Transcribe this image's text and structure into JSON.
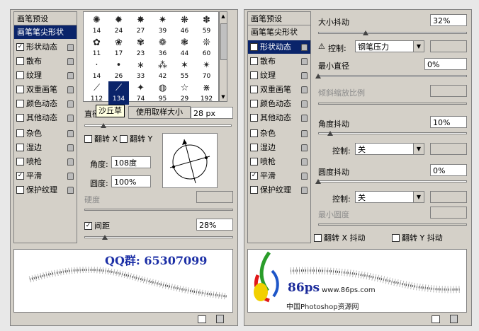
{
  "left": {
    "list": [
      {
        "label": "画笔预设",
        "check": false,
        "lock": false,
        "header": true
      },
      {
        "label": "画笔笔尖形状",
        "check": false,
        "lock": false,
        "selected": true
      },
      {
        "label": "形状动态",
        "check": true,
        "lock": true
      },
      {
        "label": "散布",
        "check": false,
        "lock": true
      },
      {
        "label": "纹理",
        "check": false,
        "lock": true
      },
      {
        "label": "双重画笔",
        "check": false,
        "lock": true
      },
      {
        "label": "颜色动态",
        "check": false,
        "lock": true
      },
      {
        "label": "其他动态",
        "check": false,
        "lock": true
      },
      {
        "label": "杂色",
        "check": false,
        "lock": true
      },
      {
        "label": "湿边",
        "check": false,
        "lock": true
      },
      {
        "label": "喷枪",
        "check": false,
        "lock": true
      },
      {
        "label": "平滑",
        "check": true,
        "lock": true
      },
      {
        "label": "保护纹理",
        "check": false,
        "lock": true
      }
    ],
    "brush_sizes": [
      "14",
      "24",
      "27",
      "39",
      "46",
      "59",
      "11",
      "17",
      "23",
      "36",
      "44",
      "60",
      "14",
      "26",
      "33",
      "42",
      "55",
      "70",
      "112",
      "134",
      "74",
      "95",
      "29",
      "192"
    ],
    "tooltip": "沙丘草",
    "diameter_label": "直径",
    "use_sample_button": "使用取样大小",
    "diameter_value": "28 px",
    "flip_x": "翻转 X",
    "flip_y": "翻转 Y",
    "angle_label": "角度:",
    "angle_value": "108度",
    "roundness_label": "圆度:",
    "roundness_value": "100%",
    "hardness_label": "硬度",
    "spacing_label": "间距",
    "spacing_value": "28%",
    "watermark": "QQ群: 65307099"
  },
  "right": {
    "list": [
      {
        "label": "画笔预设",
        "check": false,
        "lock": false,
        "header": true
      },
      {
        "label": "画笔笔尖形状",
        "check": false,
        "lock": false
      },
      {
        "label": "形状动态",
        "check": true,
        "lock": true,
        "selected": true
      },
      {
        "label": "散布",
        "check": false,
        "lock": true
      },
      {
        "label": "纹理",
        "check": false,
        "lock": true
      },
      {
        "label": "双重画笔",
        "check": false,
        "lock": true
      },
      {
        "label": "颜色动态",
        "check": false,
        "lock": true
      },
      {
        "label": "其他动态",
        "check": false,
        "lock": true
      },
      {
        "label": "杂色",
        "check": false,
        "lock": true
      },
      {
        "label": "湿边",
        "check": false,
        "lock": true
      },
      {
        "label": "喷枪",
        "check": false,
        "lock": true
      },
      {
        "label": "平滑",
        "check": true,
        "lock": true
      },
      {
        "label": "保护纹理",
        "check": false,
        "lock": true
      }
    ],
    "size_jitter_label": "大小抖动",
    "size_jitter_value": "32%",
    "size_jitter_level": 0.32,
    "control_label": "控制:",
    "control_value_pen": "钢笔压力",
    "min_diameter_label": "最小直径",
    "min_diameter_value": "0%",
    "tilt_scale_label": "倾斜缩放比例",
    "angle_jitter_label": "角度抖动",
    "angle_jitter_value": "10%",
    "control_off": "关",
    "roundness_jitter_label": "圆度抖动",
    "roundness_jitter_value": "0%",
    "min_roundness_label": "最小圆度",
    "flip_x_jitter": "翻转 X 抖动",
    "flip_y_jitter": "翻转 Y 抖动",
    "site_url": "www.86ps.com",
    "site_name": "中国Photoshop资源网",
    "logo_text": "86ps"
  }
}
